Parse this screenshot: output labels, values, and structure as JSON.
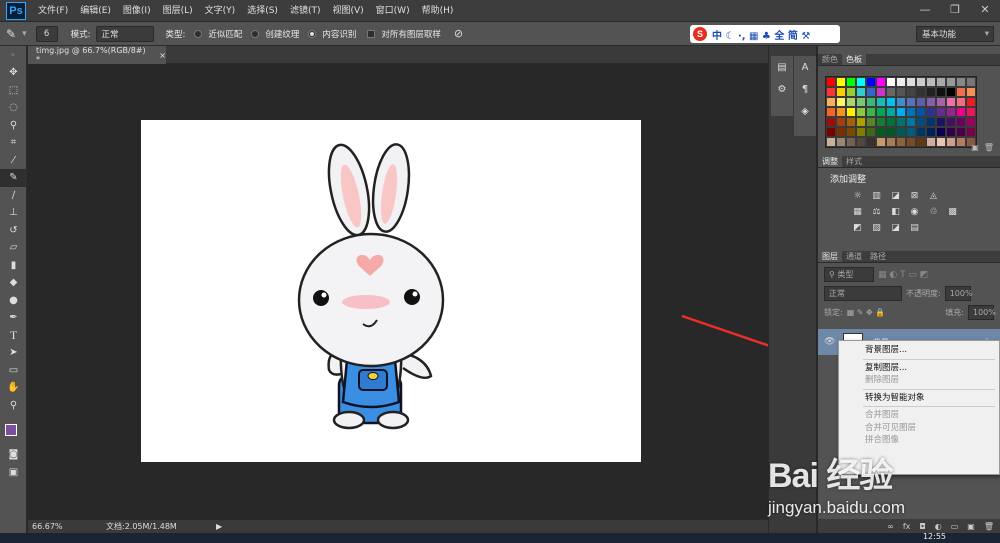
{
  "app": {
    "logo": "Ps"
  },
  "menu": [
    "文件(F)",
    "编辑(E)",
    "图像(I)",
    "图层(L)",
    "文字(Y)",
    "选择(S)",
    "滤镜(T)",
    "视图(V)",
    "窗口(W)",
    "帮助(H)"
  ],
  "window_buttons": [
    "—",
    "❐",
    "✕"
  ],
  "options": {
    "brush_size": "6",
    "mode_label": "模式:",
    "mode_value": "正常",
    "type_label": "类型:",
    "radio_1": "近似匹配",
    "radio_2": "创建纹理",
    "radio_3": "内容识别",
    "checkbox": "对所有图层取样",
    "workspace": "基本功能"
  },
  "ime": {
    "s": "S",
    "text": "中 ☾ ·, ▦ ♣ 全 简 ⚒"
  },
  "document": {
    "tab_title": "timg.jpg @ 66.7%(RGB/8#) *",
    "close": "×"
  },
  "status": {
    "zoom": "66.67%",
    "doc_info": "文档:2.05M/1.48M",
    "arrow": "▶"
  },
  "swatches_panel": {
    "tab_1": "颜色",
    "tab_2": "色板",
    "colors": [
      "#ff0000",
      "#ffff00",
      "#00ff00",
      "#00ffff",
      "#0000ff",
      "#ff00ff",
      "#ffffff",
      "#eeeeee",
      "#dddddd",
      "#cccccc",
      "#bbbbbb",
      "#aaaaaa",
      "#999999",
      "#888888",
      "#777777",
      "#ff3333",
      "#ffcc00",
      "#99cc33",
      "#33cccc",
      "#3366cc",
      "#cc33cc",
      "#666666",
      "#555555",
      "#444444",
      "#333333",
      "#222222",
      "#111111",
      "#000000",
      "#f26c4f",
      "#f68e55",
      "#fbaf5c",
      "#fff467",
      "#acd372",
      "#7cc576",
      "#3bb878",
      "#1abbb4",
      "#00bff3",
      "#438ccb",
      "#5574b9",
      "#605ca8",
      "#855fa8",
      "#a763a8",
      "#f06ea9",
      "#f26d7d",
      "#ed1c24",
      "#f26522",
      "#f7941d",
      "#fff200",
      "#8dc73f",
      "#39b54a",
      "#00a651",
      "#00a99d",
      "#00aeef",
      "#0072bc",
      "#0054a6",
      "#2e3192",
      "#662d91",
      "#92278f",
      "#ec008c",
      "#ed145b",
      "#9e0b0f",
      "#a0410d",
      "#a3620a",
      "#aba000",
      "#598527",
      "#197b30",
      "#007236",
      "#00746b",
      "#0076a3",
      "#004b80",
      "#003471",
      "#1b1464",
      "#440e62",
      "#630460",
      "#9e005d",
      "#790000",
      "#7b2e00",
      "#7d4900",
      "#827b00",
      "#406618",
      "#005e20",
      "#005826",
      "#005952",
      "#005b7f",
      "#003663",
      "#002157",
      "#0d004c",
      "#32004b",
      "#4b0049",
      "#7b0046",
      "#c7b299",
      "#998675",
      "#736357",
      "#534741",
      "#37302d",
      "#c69c6d",
      "#a67c52",
      "#8c6239",
      "#754c24",
      "#603913",
      "#d0ada0",
      "#e6c3b5",
      "#cfa18d",
      "#b77b64",
      "#8a5a44"
    ]
  },
  "adjust_panel": {
    "tab_1": "调整",
    "tab_2": "样式",
    "heading": "添加调整",
    "icons_row1": [
      "☼",
      "▥",
      "◪",
      "⊠",
      "◬"
    ],
    "icons_row2": [
      "▦",
      "⚖",
      "◧",
      "◉",
      "♲",
      "▩"
    ],
    "icons_row3": [
      "◩",
      "▨",
      "◪",
      "▤"
    ]
  },
  "layers_panel": {
    "tab_1": "图层",
    "tab_2": "通道",
    "tab_3": "路径",
    "kind": "类型",
    "blend": "正常",
    "opacity_label": "不透明度:",
    "opacity": "100%",
    "lock_label": "锁定:",
    "fill_label": "填充:",
    "fill": "100%",
    "layer_name": "背景"
  },
  "context_menu": {
    "items": [
      {
        "label": "背景图层...",
        "disabled": false
      },
      {
        "sep": true
      },
      {
        "label": "复制图层...",
        "disabled": false
      },
      {
        "label": "删除图层",
        "disabled": true
      },
      {
        "sep": true
      },
      {
        "label": "转换为智能对象",
        "disabled": false
      },
      {
        "sep": true
      },
      {
        "label": "合并图层",
        "disabled": true
      },
      {
        "label": "合并可见图层",
        "disabled": true
      },
      {
        "label": "拼合图像",
        "disabled": true
      }
    ]
  },
  "watermark": {
    "logo": "Bai 经验",
    "url": "jingyan.baidu.com"
  },
  "taskbar": {
    "time": "12:55"
  },
  "accent": {
    "arrow": "#e8302a",
    "selected_layer": "#6f88a7"
  }
}
